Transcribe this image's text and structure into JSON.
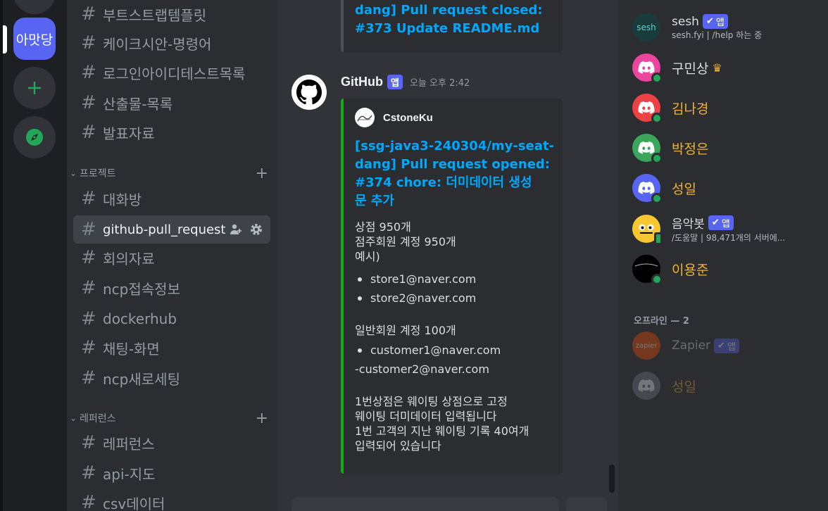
{
  "servers": [
    {
      "label": "아맛당",
      "selected": true
    }
  ],
  "channels": [
    {
      "label": "부트스트랩템플릿"
    },
    {
      "label": "케이크시안-명령어"
    },
    {
      "label": "로그인아이디테스트목록"
    },
    {
      "label": "산출물-목록"
    },
    {
      "label": "발표자료"
    }
  ],
  "categories": {
    "project": "프로젝트",
    "reference": "레퍼런스"
  },
  "project_channels": [
    {
      "label": "대화방"
    },
    {
      "label": "github-pull_request",
      "active": true
    },
    {
      "label": "회의자료"
    },
    {
      "label": "ncp접속정보"
    },
    {
      "label": "dockerhub"
    },
    {
      "label": "채팅-화면"
    },
    {
      "label": "ncp새로세팅"
    }
  ],
  "reference_channels": [
    {
      "label": "레퍼런스"
    },
    {
      "label": "api-지도"
    },
    {
      "label": "csv데이터"
    }
  ],
  "prev_embed": {
    "line1": "dang] Pull request closed:",
    "line2": "#373 Update README.md"
  },
  "message": {
    "author": "GitHub",
    "app_tag": "앱",
    "timestamp": "오늘 오후 2:42",
    "embed": {
      "embed_author": "CstoneKu",
      "title_lines": [
        "[ssg-java3-240304/my-seat-",
        "dang] Pull request opened:",
        "#374 chore: 더미데이터 생성",
        "문 추가"
      ],
      "lines_a": [
        "상점 950개",
        "점주회원 계정 950개",
        "예시)"
      ],
      "bullets_a": [
        "store1@naver.com",
        "store2@naver.com"
      ],
      "line_b": "일반회원 계정 100개",
      "bullets_b": [
        "customer1@naver.com"
      ],
      "plain_b": "-customer2@naver.com",
      "lines_c": [
        "1번상점은 웨이팅 상점으로 고정",
        "웨이팅 더미데이터 입력됩니다",
        "1번 고객의 지난 웨이팅 기록 40여개",
        "입력되어 있습니다"
      ],
      "accent": "#17a81a"
    }
  },
  "members_online": [
    {
      "name": "sesh",
      "badge": "앱",
      "sub": "sesh.fyi | /help 하는 중",
      "color": "#dbdee1",
      "avatar": "sesh"
    },
    {
      "name": "구민상",
      "crown": true,
      "color": "#dbdee1",
      "avatar_color": "#eb459e"
    },
    {
      "name": "김나경",
      "color": "#f0b232",
      "avatar_color": "#ed4245"
    },
    {
      "name": "박정은",
      "color": "#f0b232",
      "avatar_color": "#3ba55c"
    },
    {
      "name": "성일",
      "color": "#f0b232",
      "avatar_color": "#5865f2"
    },
    {
      "name": "음악봇",
      "badge": "앱",
      "sub": "/도움말 | 98,471개의 서버에...",
      "color": "#dbdee1",
      "avatar_color": "#f8c630"
    },
    {
      "name": "이용준",
      "color": "#f0b232",
      "avatar_color": "#000000"
    }
  ],
  "offline_title": "오프라인 — 2",
  "members_offline": [
    {
      "name": "Zapier",
      "badge": "앱",
      "avatar_text": "zapier",
      "avatar_color": "#ff4f00"
    },
    {
      "name": "성일",
      "avatar_color": "#747f8d"
    }
  ]
}
